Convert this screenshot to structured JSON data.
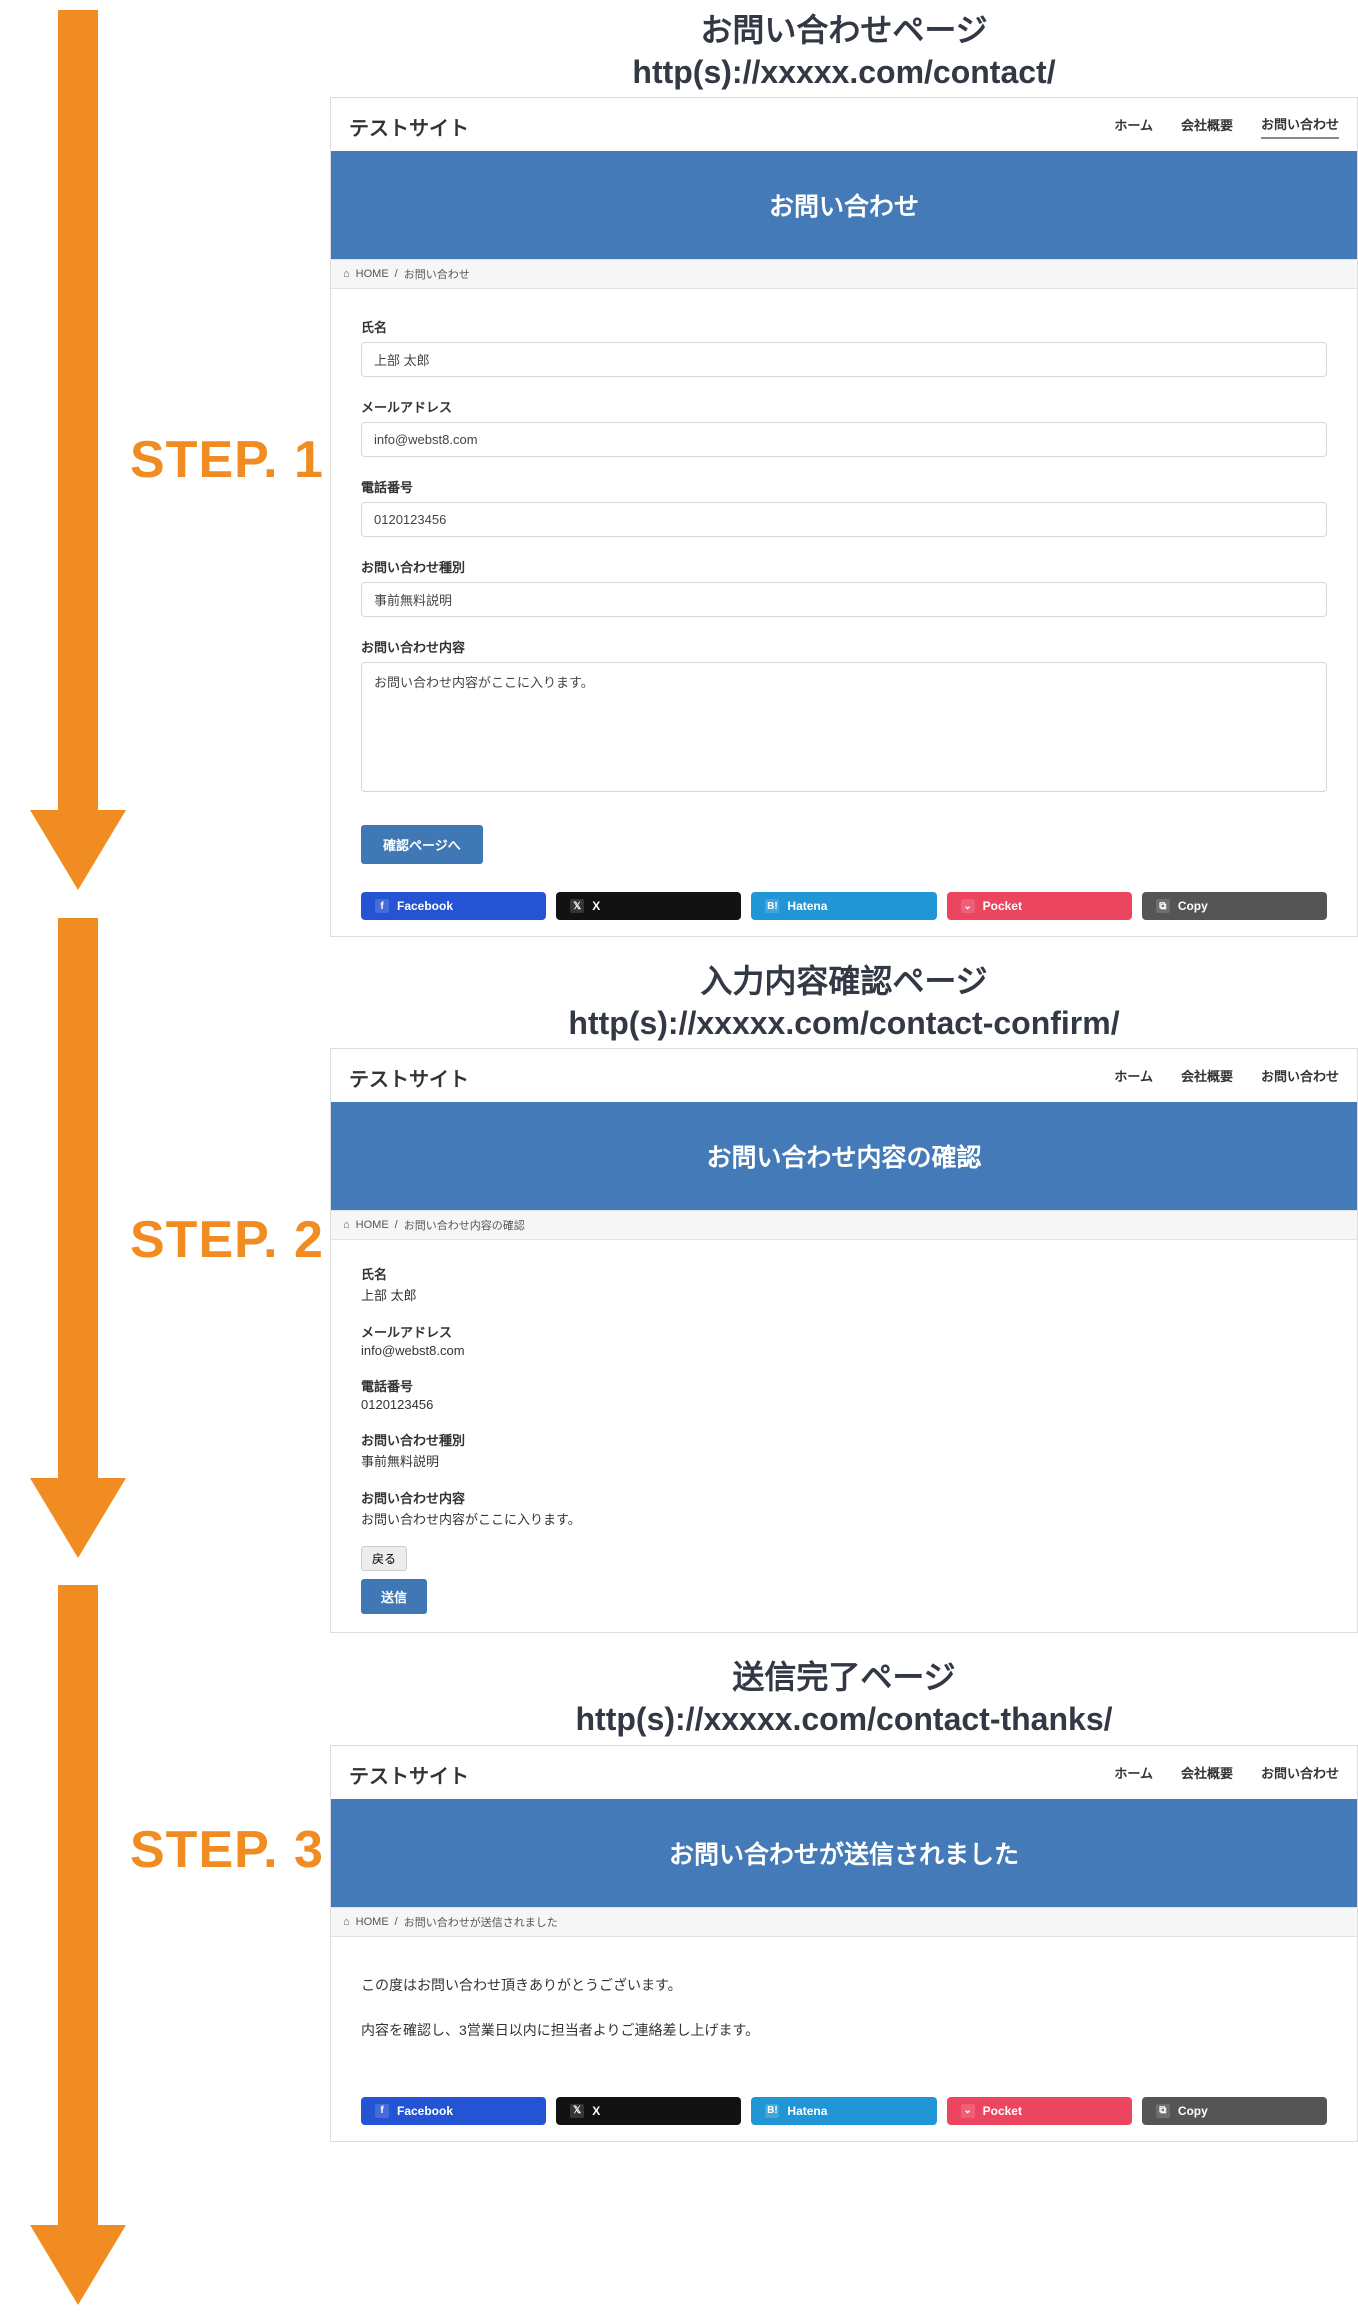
{
  "steps": {
    "s1": "STEP. 1",
    "s2": "STEP. 2",
    "s3": "STEP. 3"
  },
  "sections": {
    "contact": {
      "heading_title": "お問い合わせページ",
      "heading_url": "http(s)://xxxxx.com/contact/",
      "site_title": "テストサイト",
      "nav": {
        "home": "ホーム",
        "company": "会社概要",
        "contact": "お問い合わせ"
      },
      "hero": "お問い合わせ",
      "breadcrumb": {
        "home": "HOME",
        "sep": "/",
        "current": "お問い合わせ"
      },
      "form": {
        "name_label": "氏名",
        "name_value": "上部 太郎",
        "email_label": "メールアドレス",
        "email_value": "info@webst8.com",
        "phone_label": "電話番号",
        "phone_value": "0120123456",
        "type_label": "お問い合わせ種別",
        "type_value": "事前無料説明",
        "content_label": "お問い合わせ内容",
        "content_value": "お問い合わせ内容がここに入ります。",
        "confirm_button": "確認ページへ"
      },
      "share": {
        "fb": "Facebook",
        "x": "X",
        "hatena": "Hatena",
        "pocket": "Pocket",
        "copy": "Copy"
      }
    },
    "confirm": {
      "heading_title": "入力内容確認ページ",
      "heading_url": "http(s)://xxxxx.com/contact-confirm/",
      "site_title": "テストサイト",
      "nav": {
        "home": "ホーム",
        "company": "会社概要",
        "contact": "お問い合わせ"
      },
      "hero": "お問い合わせ内容の確認",
      "breadcrumb": {
        "home": "HOME",
        "sep": "/",
        "current": "お問い合わせ内容の確認"
      },
      "fields": {
        "name_label": "氏名",
        "name_value": "上部 太郎",
        "email_label": "メールアドレス",
        "email_value": "info@webst8.com",
        "phone_label": "電話番号",
        "phone_value": "0120123456",
        "type_label": "お問い合わせ種別",
        "type_value": "事前無料説明",
        "content_label": "お問い合わせ内容",
        "content_value": "お問い合わせ内容がここに入ります。"
      },
      "back_button": "戻る",
      "send_button": "送信"
    },
    "thanks": {
      "heading_title": "送信完了ページ",
      "heading_url": "http(s)://xxxxx.com/contact-thanks/",
      "site_title": "テストサイト",
      "nav": {
        "home": "ホーム",
        "company": "会社概要",
        "contact": "お問い合わせ"
      },
      "hero": "お問い合わせが送信されました",
      "breadcrumb": {
        "home": "HOME",
        "sep": "/",
        "current": "お問い合わせが送信されました"
      },
      "body1": "この度はお問い合わせ頂きありがとうございます。",
      "body2": "内容を確認し、3営業日以内に担当者よりご連絡差し上げます。",
      "share": {
        "fb": "Facebook",
        "x": "X",
        "hatena": "Hatena",
        "pocket": "Pocket",
        "copy": "Copy"
      }
    }
  }
}
